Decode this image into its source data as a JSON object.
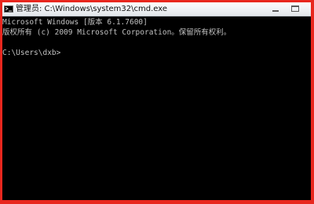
{
  "window": {
    "title": "管理员: C:\\Windows\\system32\\cmd.exe",
    "icon": "cmd-icon"
  },
  "controls": {
    "minimize_icon": "minimize-icon",
    "maximize_icon": "maximize-icon"
  },
  "console": {
    "lines": [
      "Microsoft Windows [版本 6.1.7600]",
      "版权所有 (c) 2009 Microsoft Corporation。保留所有权利。",
      "",
      "C:\\Users\\dxb>"
    ]
  },
  "colors": {
    "frame": "#e8271e",
    "console_bg": "#000000",
    "console_text": "#c0c0c0"
  }
}
